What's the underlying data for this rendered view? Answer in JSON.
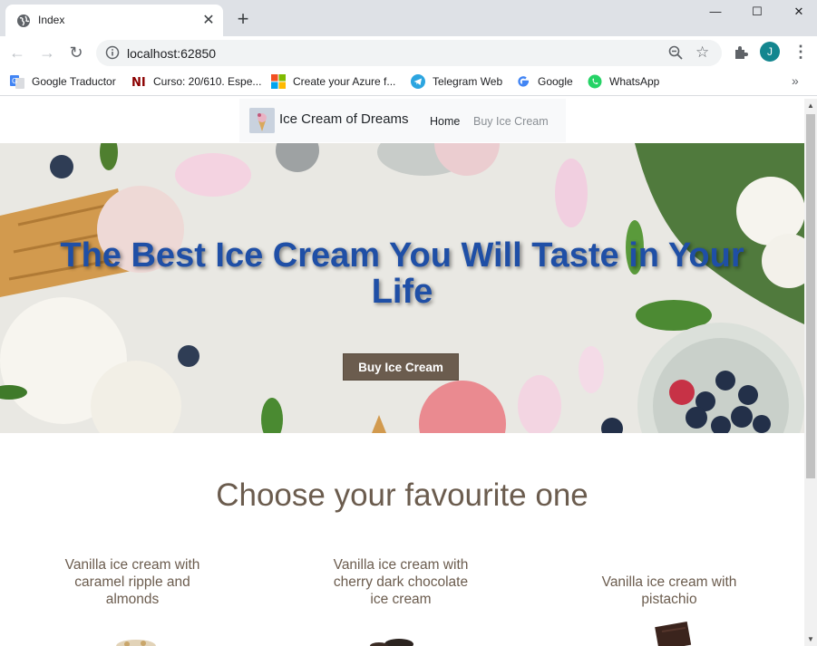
{
  "browser": {
    "tab_title": "Index",
    "url": "localhost:62850",
    "profile_initial": "J",
    "bookmarks": [
      {
        "label": "Google Traductor",
        "icon": "google-translate-icon"
      },
      {
        "label": "Curso: 20/610. Espe...",
        "icon": "ni-icon"
      },
      {
        "label": "Create your Azure f...",
        "icon": "microsoft-icon"
      },
      {
        "label": "Telegram Web",
        "icon": "telegram-icon"
      },
      {
        "label": "Google",
        "icon": "google-icon"
      },
      {
        "label": "WhatsApp",
        "icon": "whatsapp-icon"
      }
    ],
    "more_glyph": "»"
  },
  "site": {
    "brand": "Ice Cream of Dreams",
    "nav": {
      "home": "Home",
      "buy": "Buy Ice Cream"
    },
    "hero": {
      "title": "The Best Ice Cream You Will Taste in Your Life",
      "button": "Buy Ice Cream"
    },
    "section_title": "Choose your favourite one",
    "products": [
      {
        "name": "Vanilla ice cream with caramel ripple and almonds"
      },
      {
        "name": "Vanilla ice cream with cherry dark chocolate ice cream"
      },
      {
        "name": "Vanilla ice cream with pistachio"
      }
    ]
  },
  "colors": {
    "accent_brown": "#6b5c4e",
    "hero_title_blue": "#1f4fa6",
    "profile_teal": "#13868f"
  }
}
